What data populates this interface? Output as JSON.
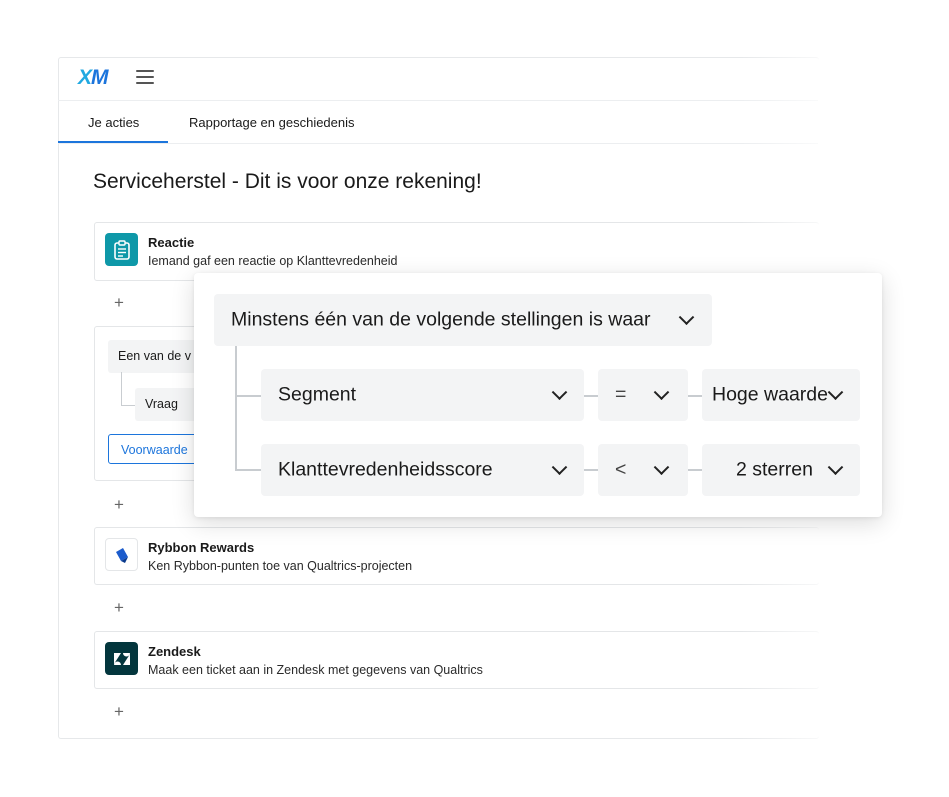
{
  "app": {
    "logo": {
      "x": "X",
      "m": "M"
    },
    "tabs": [
      {
        "label": "Je acties",
        "active": true
      },
      {
        "label": "Rapportage en geschiedenis",
        "active": false
      }
    ],
    "page_title": "Serviceherstel - Dit is voor onze rekening!"
  },
  "cards": {
    "reactie": {
      "title": "Reactie",
      "subtitle": "Iemand gaf een reactie op Klanttevredenheid",
      "icon": "clipboard-icon",
      "color": "#0e98a8"
    },
    "conditie": {
      "label": "Een van de v",
      "sub_label": "Vraag",
      "button": "Voorwaarde"
    },
    "rybbon": {
      "title": "Rybbon Rewards",
      "subtitle": "Ken Rybbon-punten toe van Qualtrics-projecten",
      "icon": "rybbon-icon",
      "color": "#1c5ccc"
    },
    "zendesk": {
      "title": "Zendesk",
      "subtitle": "Maak een ticket aan in Zendesk met gegevens van Qualtrics",
      "icon": "zendesk-icon",
      "color": "#03363d"
    }
  },
  "popover": {
    "group_label": "Minstens één van de volgende stellingen is waar",
    "conditions": [
      {
        "field": "Segment",
        "operator": "=",
        "value": "Hoge waarde"
      },
      {
        "field": "Klanttevredenheidsscore",
        "operator": "<",
        "value": "2 sterren"
      }
    ]
  },
  "colors": {
    "accent": "#1c75dc",
    "pill_bg": "#f3f4f5"
  }
}
